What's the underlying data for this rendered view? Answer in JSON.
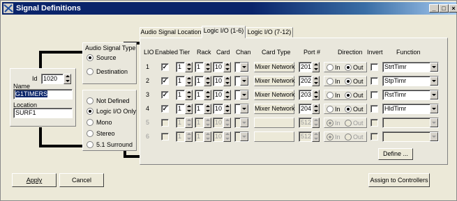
{
  "window": {
    "title": "Signal Definitions"
  },
  "window_controls": [
    "minimize-icon",
    "maximize-icon",
    "close-icon"
  ],
  "left": {
    "id_label": "Id",
    "id_value": "1020",
    "name_label": "Name",
    "name_value": "G1TIMERS",
    "location_label": "Location",
    "location_value": "SURF1"
  },
  "audio_signal_type": {
    "title": "Audio Signal Type",
    "source": "Source",
    "destination": "Destination",
    "selected": "Source"
  },
  "format": {
    "options": [
      "Not Defined",
      "Logic I/O Only",
      "Mono",
      "Stereo",
      "5.1 Surround"
    ],
    "selected": "Logic I/O Only"
  },
  "tabs": [
    {
      "label": "Audio Signal Location",
      "active": false
    },
    {
      "label": "Logic I/O (1-6)",
      "active": true
    },
    {
      "label": "Logic I/O (7-12)",
      "active": false
    }
  ],
  "grid": {
    "headers": {
      "lio": "LIO",
      "enabled": "Enabled",
      "tier": "Tier",
      "rack": "Rack",
      "card": "Card",
      "chan": "Chan",
      "card_type": "Card Type",
      "port": "Port #",
      "direction": "Direction",
      "invert": "Invert",
      "function": "Function"
    },
    "rows": [
      {
        "lio": "1",
        "enabled": true,
        "tier": "1",
        "rack": "1",
        "card": "10",
        "chan": "",
        "card_type": "Mixer Network",
        "port": "201",
        "in_label": "In",
        "out_label": "Out",
        "direction": "Out",
        "invert": false,
        "function": "StrtTimr",
        "disabled": false
      },
      {
        "lio": "2",
        "enabled": true,
        "tier": "1",
        "rack": "1",
        "card": "10",
        "chan": "",
        "card_type": "Mixer Network",
        "port": "202",
        "in_label": "In",
        "out_label": "Out",
        "direction": "Out",
        "invert": false,
        "function": "StpTimr",
        "disabled": false
      },
      {
        "lio": "3",
        "enabled": true,
        "tier": "1",
        "rack": "1",
        "card": "10",
        "chan": "",
        "card_type": "Mixer Network",
        "port": "203",
        "in_label": "In",
        "out_label": "Out",
        "direction": "Out",
        "invert": false,
        "function": "RstTimr",
        "disabled": false
      },
      {
        "lio": "4",
        "enabled": true,
        "tier": "1",
        "rack": "1",
        "card": "10",
        "chan": "",
        "card_type": "Mixer Network",
        "port": "204",
        "in_label": "In",
        "out_label": "Out",
        "direction": "Out",
        "invert": false,
        "function": "HldTimr",
        "disabled": false
      },
      {
        "lio": "5",
        "enabled": false,
        "tier": "1",
        "rack": "1",
        "card": "10",
        "chan": "",
        "card_type": "",
        "port": "512",
        "in_label": "In",
        "out_label": "Out",
        "direction": "In",
        "invert": false,
        "function": "",
        "disabled": true
      },
      {
        "lio": "6",
        "enabled": false,
        "tier": "1",
        "rack": "1",
        "card": "10",
        "chan": "",
        "card_type": "",
        "port": "512",
        "in_label": "In",
        "out_label": "Out",
        "direction": "In",
        "invert": false,
        "function": "",
        "disabled": true
      }
    ],
    "define_button": "Define ..."
  },
  "footer": {
    "apply": "Apply",
    "cancel": "Cancel",
    "assign": "Assign to Controllers"
  }
}
